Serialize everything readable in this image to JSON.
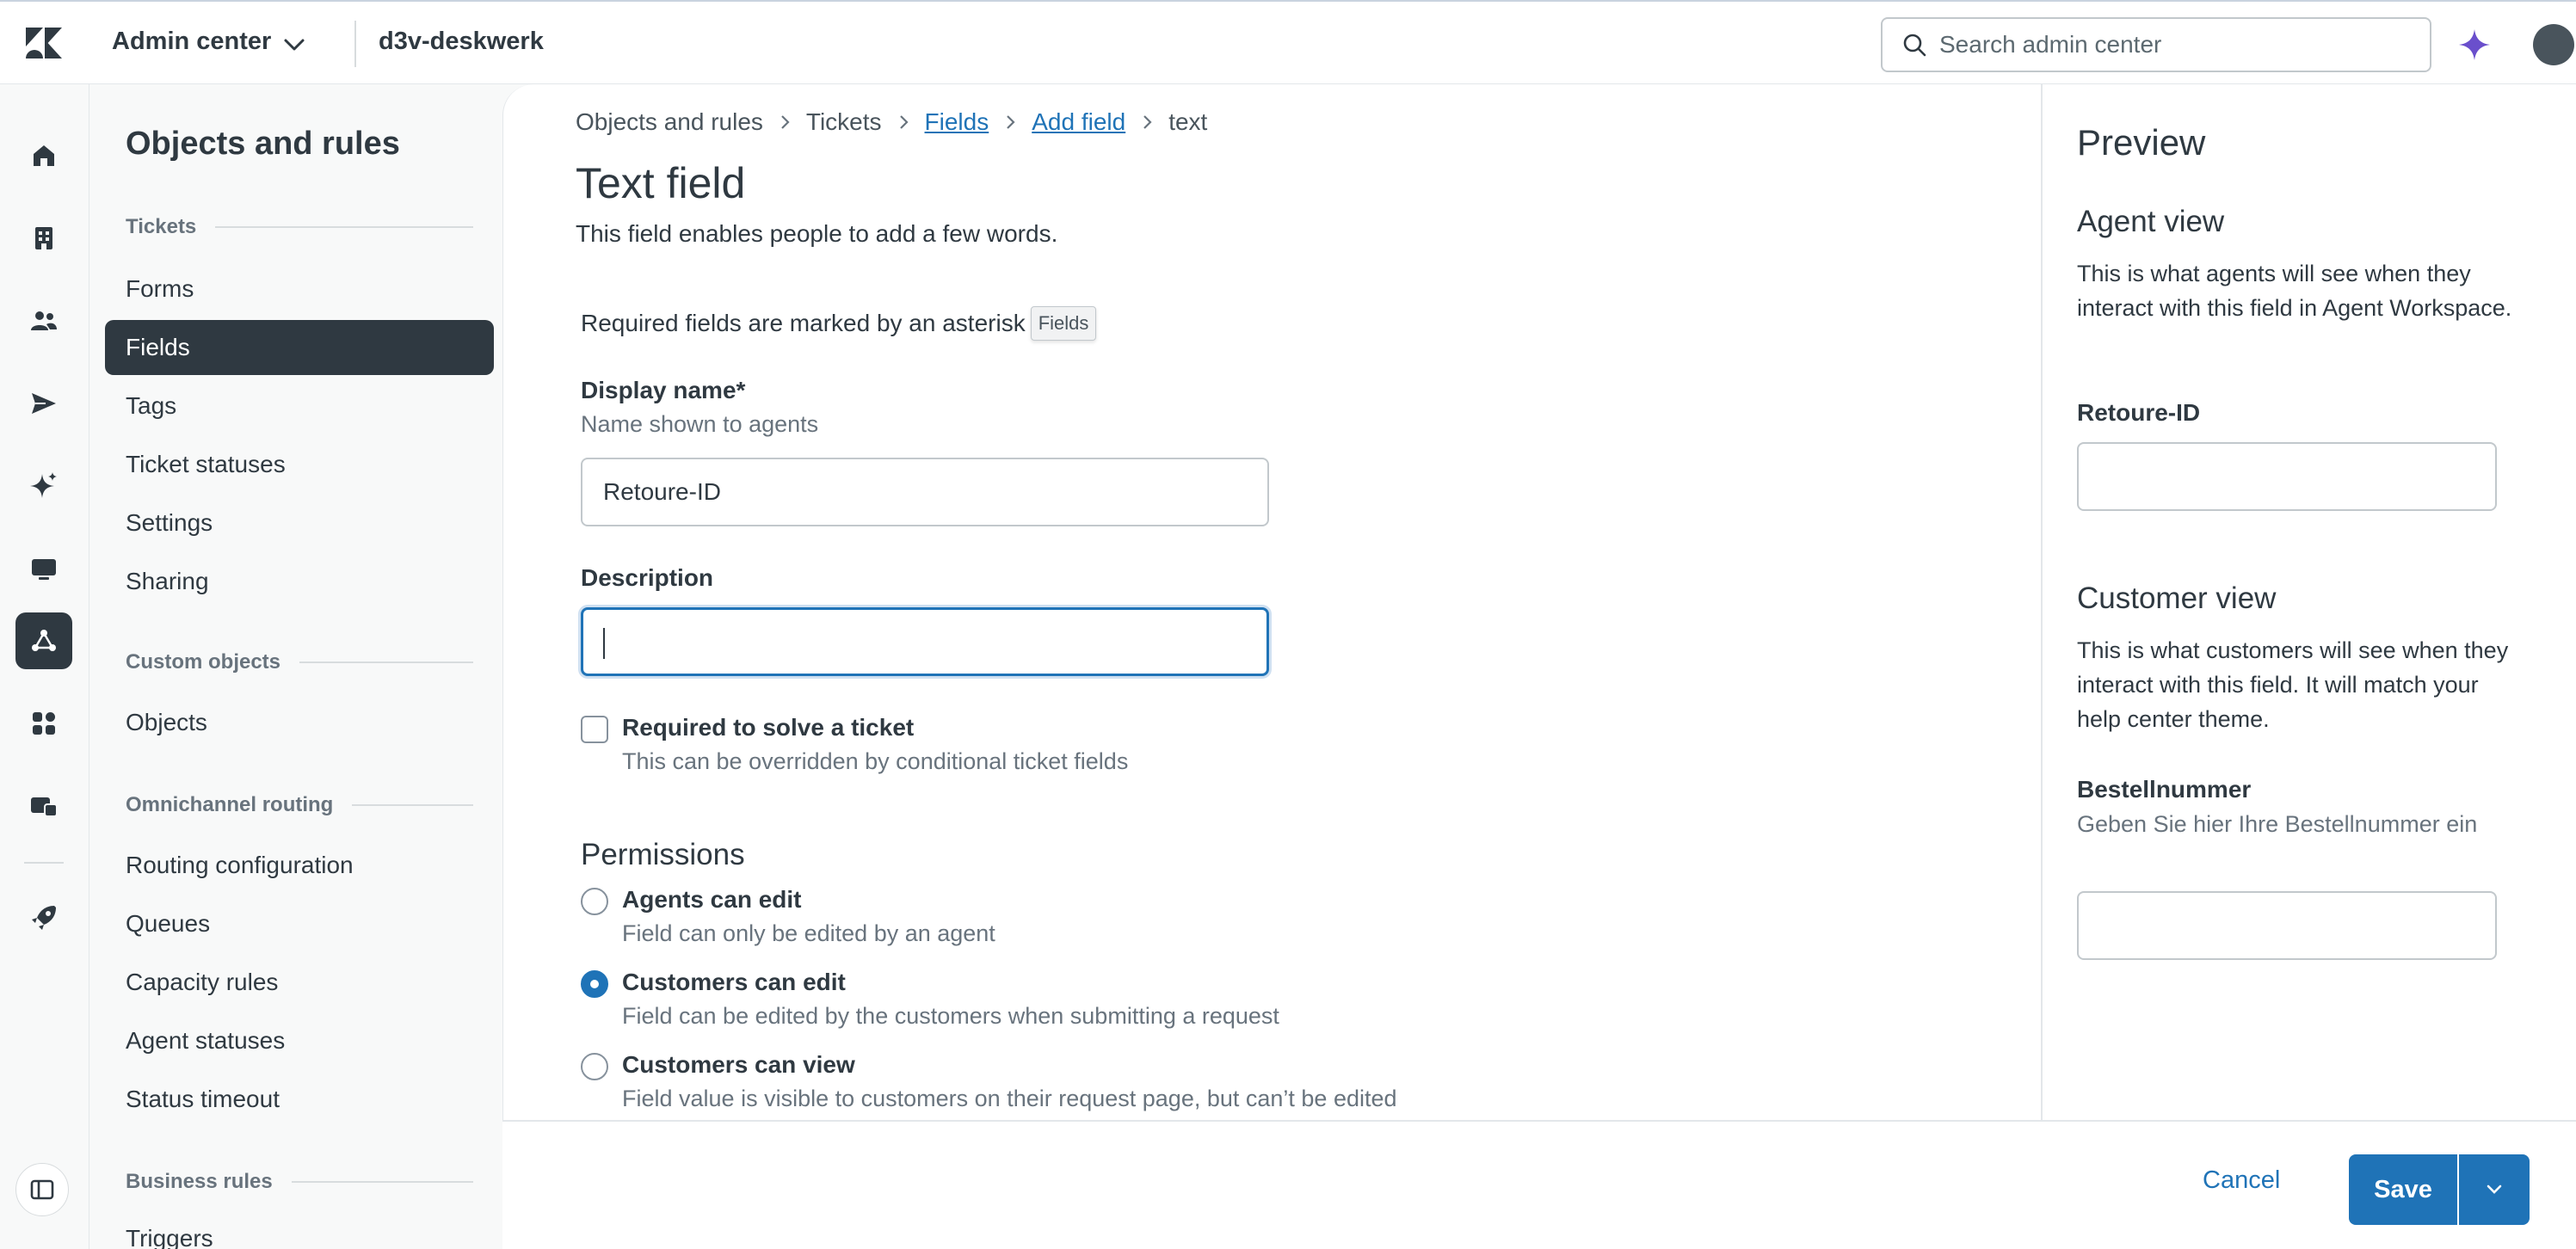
{
  "header": {
    "product_name": "Admin center",
    "account_name": "d3v-deskwerk",
    "search_placeholder": "Search admin center"
  },
  "subnav": {
    "title": "Objects and rules",
    "sections": [
      {
        "heading": "Tickets",
        "items": [
          "Forms",
          "Fields",
          "Tags",
          "Ticket statuses",
          "Settings",
          "Sharing"
        ]
      },
      {
        "heading": "Custom objects",
        "items": [
          "Objects"
        ]
      },
      {
        "heading": "Omnichannel routing",
        "items": [
          "Routing configuration",
          "Queues",
          "Capacity rules",
          "Agent statuses",
          "Status timeout"
        ]
      },
      {
        "heading": "Business rules",
        "items": [
          "Triggers"
        ]
      }
    ],
    "active_item": "Fields"
  },
  "breadcrumb": {
    "items": [
      "Objects and rules",
      "Tickets",
      "Fields",
      "Add field",
      "text"
    ]
  },
  "page": {
    "title": "Text field",
    "subtitle": "This field enables people to add a few words.",
    "required_note": "Required fields are marked by an asterisk",
    "tooltip": "Fields"
  },
  "form": {
    "display_name_label": "Display name*",
    "display_name_hint": "Name shown to agents",
    "display_name_value": "Retoure-ID",
    "description_label": "Description",
    "description_value": "",
    "required_label": "Required to solve a ticket",
    "required_hint": "This can be overridden by conditional ticket fields",
    "permissions_heading": "Permissions",
    "permissions": [
      {
        "label": "Agents can edit",
        "hint": "Field can only be edited by an agent",
        "checked": false
      },
      {
        "label": "Customers can edit",
        "hint": "Field can be edited by the customers when submitting a request",
        "checked": true
      },
      {
        "label": "Customers can view",
        "hint": "Field value is visible to customers on their request page, but can’t be edited",
        "checked": false
      }
    ]
  },
  "preview": {
    "title": "Preview",
    "agent_view_heading": "Agent view",
    "agent_view_text": "This is what agents will see when they interact with this field in Agent Workspace.",
    "agent_field_label": "Retoure-ID",
    "customer_view_heading": "Customer view",
    "customer_view_text": "This is what customers will see when they interact with this field. It will match your help center theme.",
    "customer_field_label": "Bestellnummer",
    "customer_field_hint": "Geben Sie hier Ihre Bestellnummer ein"
  },
  "footer": {
    "cancel_label": "Cancel",
    "save_label": "Save"
  },
  "colors": {
    "accent": "#1f73b7",
    "nav_active": "#2f3941",
    "sparkle": "#6a4fcc"
  }
}
